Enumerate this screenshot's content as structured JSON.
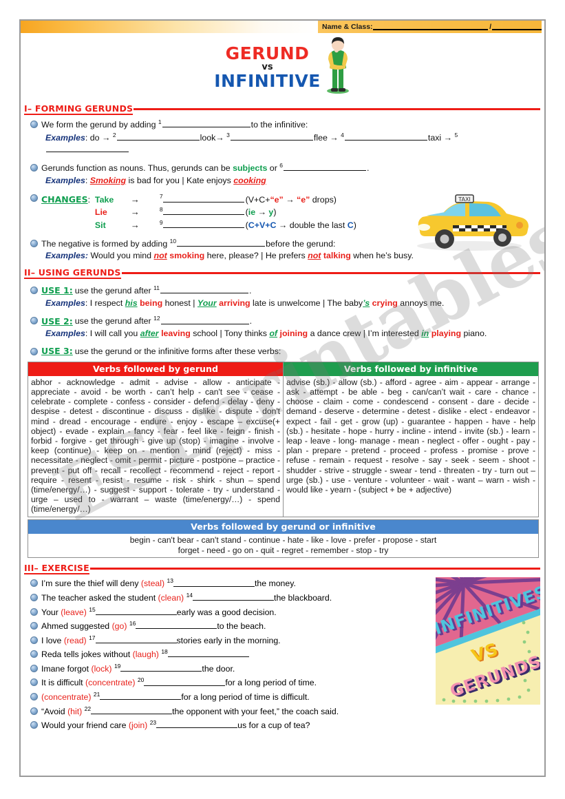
{
  "header": {
    "name_label": "Name & Class:",
    "separator": "/"
  },
  "title": {
    "gerund": "GERUND",
    "vs": "vs",
    "infinitive": "INFINITIVE"
  },
  "watermark": "ESLprintables.com",
  "sections": {
    "forming": {
      "heading": "I– FORMING GERUNDS",
      "rule1_pre": "We form the gerund by adding",
      "rule1_num": "1",
      "rule1_post": "to the infinitive:",
      "examples1_label": "Examples",
      "ex1_do": "do →",
      "ex1_n2": "2",
      "ex1_look": "look→",
      "ex1_n3": "3",
      "ex1_flee": "flee →",
      "ex1_n4": "4",
      "ex1_taxi": "taxi →",
      "ex1_n5": "5",
      "rule2_pre": "Gerunds function as nouns. Thus, gerunds can be",
      "rule2_subjects": "subjects",
      "rule2_or": "or",
      "rule2_num": "6",
      "rule2_end": ".",
      "examples2_label": "Examples",
      "ex2_smoking": "Smoking",
      "ex2_mid": "is bad for you | Kate enjoys",
      "ex2_cooking": "cooking",
      "changes_label": "CHANGES",
      "changes_colon": ":",
      "changes": [
        {
          "verb": "Take",
          "arrow": "→",
          "num": "7",
          "note_open": "(V+C+",
          "note_e1": "“e”",
          "note_arrow": " → ",
          "note_e2": "“e”",
          "note_close": " drops)"
        },
        {
          "verb": "Lie",
          "arrow": "→",
          "num": "8",
          "note_open": "(",
          "note_ie": "ie",
          "note_mid": " → ",
          "note_y": "y",
          "note_close": ")"
        },
        {
          "verb": "Sit",
          "arrow": "→",
          "num": "9",
          "note_open": "(",
          "note_cvc": "C+V+C",
          "note_mid": " → double the last ",
          "note_c": "C",
          "note_close": ")"
        }
      ],
      "rule3_pre": "The negative is formed by adding",
      "rule3_num": "10",
      "rule3_post": "before the gerund:",
      "examples3_label": "Examples:",
      "ex3_a_pre": "Would you mind",
      "ex3_a_not": "not",
      "ex3_a_verb": "smoking",
      "ex3_a_post": "here, please? | He prefers",
      "ex3_b_not": "not",
      "ex3_b_verb": "talking",
      "ex3_b_post": "when he’s busy."
    },
    "using": {
      "heading": "II– USING GERUNDS",
      "use1_label": "USE 1:",
      "use1_text": "use the gerund after",
      "use1_num": "11",
      "use1_dot": ".",
      "use1_ex_label": "Examples",
      "use1_ex_p1": "I respect",
      "use1_ex_his": "his",
      "use1_ex_being": "being",
      "use1_ex_p2": "honest |",
      "use1_ex_your": "Your",
      "use1_ex_arriving": "arriving",
      "use1_ex_p3": "late is unwelcome | The baby",
      "use1_ex_s": "’s",
      "use1_ex_crying": "crying",
      "use1_ex_p4": "annoys me.",
      "use2_label": "USE 2:",
      "use2_text": "use the gerund after",
      "use2_num": "12",
      "use2_dot": ".",
      "use2_ex_label": "Examples",
      "use2_ex_p1": "I will call you",
      "use2_ex_after": "after",
      "use2_ex_leaving": "leaving",
      "use2_ex_p2": "school | Tony thinks",
      "use2_ex_of": "of",
      "use2_ex_joining": "joining",
      "use2_ex_p3": "a dance crew | I’m interested",
      "use2_ex_in": "in",
      "use2_ex_playing": "playing",
      "use2_ex_p4": "piano.",
      "use3_label": "USE 3:",
      "use3_text": "use the gerund or the infinitive forms after these verbs:"
    },
    "tables": {
      "gerund_header": "Verbs followed by gerund",
      "gerund_body": "abhor - acknowledge - admit - advise - allow - anticipate - appreciate - avoid - be worth - can’t help - can't see - cease - celebrate - complete - confess - consider - defend - delay - deny - despise - detest - discontinue - discuss - dislike - dispute - don't mind - dread - encourage - endure - enjoy - escape – excuse(+ object) - evade - explain - fancy - fear - feel like - feign - finish - forbid - forgive - get through - give up (stop) - imagine - involve - keep (continue) - keep on - mention - mind (reject) - miss - necessitate - neglect - omit - permit - picture - postpone – practice - prevent - put off - recall - recollect - recommend - reject - report - require - resent - resist - resume - risk - shirk - shun – spend (time/energy/…) - suggest - support - tolerate - try - understand - urge – used to - warrant – waste (time/energy/…) - spend (time/energy/…)",
      "infinitive_header": "Verbs followed by infinitive",
      "infinitive_body": "advise (sb.) - allow (sb.) - afford - agree - aim - appear - arrange - ask - attempt - be able - beg - can/can’t wait - care - chance - choose - claim - come - condescend - consent - dare - decide - demand - deserve - determine - detest - dislike - elect - endeavor - expect - fail - get - grow (up) - guarantee - happen - have - help (sb.) - hesitate - hope - hurry - incline - intend - invite (sb.) - learn - leap - leave - long- manage - mean - neglect - offer - ought - pay - plan - prepare - pretend - proceed - profess - promise - prove - refuse - remain - request - resolve - say - seek - seem - shoot - shudder - strive - struggle - swear - tend - threaten - try - turn out – urge (sb.) - use - venture - volunteer - wait - want – warn - wish - would like - yearn - (subject + be + adjective)",
      "both_header": "Verbs followed by gerund or infinitive",
      "both_line1": "begin - can't bear - can't stand - continue - hate - like - love - prefer - propose - start",
      "both_line2": "forget - need - go on - quit - regret - remember - stop - try"
    },
    "exercise": {
      "heading": "III– EXERCISE",
      "items": [
        {
          "pre": "I’m sure the thief will deny",
          "cue": "(steal)",
          "num": "13",
          "blank": 118,
          "post": "the money."
        },
        {
          "pre": "The teacher asked the student",
          "cue": "(clean)",
          "num": "14",
          "blank": 118,
          "post": "the blackboard."
        },
        {
          "pre": "Your",
          "cue": "(leave)",
          "num": "15",
          "blank": 118,
          "post": "early was a good decision."
        },
        {
          "pre": "Ahmed suggested",
          "cue": "(go)",
          "num": "16",
          "blank": 118,
          "post": "to the beach."
        },
        {
          "pre": "I love",
          "cue": "(read)",
          "num": "17",
          "blank": 118,
          "post": "stories early in the morning."
        },
        {
          "pre": "Reda tells jokes without",
          "cue": "(laugh)",
          "num": "18",
          "blank": 118,
          "post": ""
        },
        {
          "pre": "Imane forgot",
          "cue": "(lock)",
          "num": "19",
          "blank": 118,
          "post": "the door."
        },
        {
          "pre": "It is difficult",
          "cue": "(concentrate)",
          "num": "20",
          "blank": 118,
          "post": "for a long period of time."
        },
        {
          "pre": "",
          "cue": "(concentrate)",
          "num": "21",
          "blank": 118,
          "post": "for a long period of time is difficult."
        },
        {
          "pre": "“Avoid",
          "cue": "(hit)",
          "num": "22",
          "blank": 118,
          "post": "the opponent with your feet,” the coach said."
        },
        {
          "pre": "Would your friend care",
          "cue": "(join)",
          "num": "23",
          "blank": 118,
          "post": "us for a cup of tea?"
        }
      ],
      "poster": {
        "line1": "INFINITIVES",
        "line2": "VS",
        "line3": "GERUNDS"
      }
    }
  },
  "colors": {
    "red": "#ee1c16",
    "green": "#0f9e4f",
    "blue": "#1557b0",
    "table_blue": "#4a87cd",
    "orange": "#f6b63a"
  }
}
